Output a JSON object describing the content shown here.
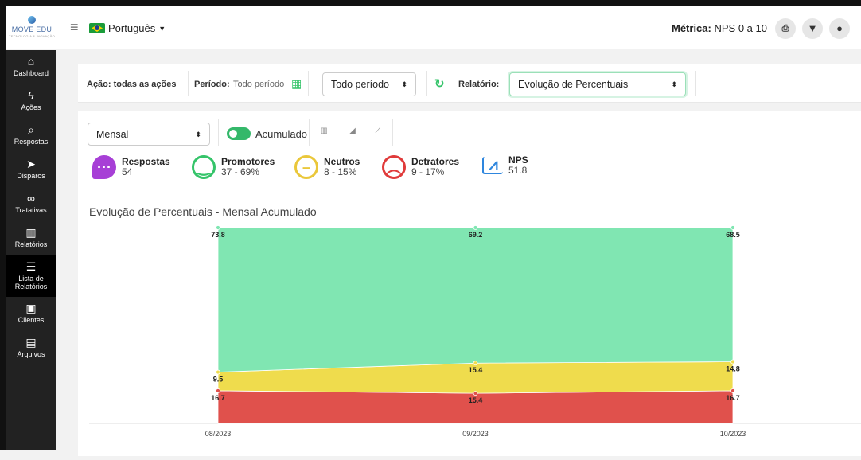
{
  "header": {
    "logo_text": "MOVE EDU",
    "logo_tagline": "TECNOLOGIA & INOVAÇÃO",
    "language": "Português",
    "metric_label": "Métrica:",
    "metric_value": "NPS 0 a 10"
  },
  "sidebar": {
    "items": [
      {
        "label": "Dashboard",
        "icon": "home-icon"
      },
      {
        "label": "Ações",
        "icon": "bolt-icon"
      },
      {
        "label": "Respostas",
        "icon": "search-icon"
      },
      {
        "label": "Disparos",
        "icon": "send-icon"
      },
      {
        "label": "Tratativas",
        "icon": "infinity-icon"
      },
      {
        "label": "Relatórios",
        "icon": "bar-chart-icon"
      },
      {
        "label": "Lista de Relatórios",
        "icon": "list-icon"
      },
      {
        "label": "Clientes",
        "icon": "contact-icon"
      },
      {
        "label": "Arquivos",
        "icon": "archive-icon"
      }
    ]
  },
  "filters": {
    "action_label": "Ação: todas as ações",
    "period_label": "Período:",
    "period_value": "Todo período",
    "period_select": "Todo período",
    "report_label": "Relatório:",
    "report_select": "Evolução de Percentuais"
  },
  "controls": {
    "interval": "Mensal",
    "cumulative_label": "Acumulado",
    "cumulative_on": true
  },
  "kpis": [
    {
      "title": "Respostas",
      "value": "54",
      "color": "#a73fd6",
      "icon": "chat-icon"
    },
    {
      "title": "Promotores",
      "value": "37 - 69%",
      "color": "#35c46a",
      "icon": "smile-icon"
    },
    {
      "title": "Neutros",
      "value": "8 - 15%",
      "color": "#eac73a",
      "icon": "neutral-face-icon"
    },
    {
      "title": "Detratores",
      "value": "9 - 17%",
      "color": "#e03b3b",
      "icon": "sad-face-icon"
    },
    {
      "title": "NPS",
      "value": "51.8",
      "color": "#2e86de",
      "icon": "trend-icon"
    }
  ],
  "chart_data": {
    "type": "area",
    "stacked": true,
    "title": "Evolução de Percentuais - Mensal Acumulado",
    "x": [
      "08/2023",
      "09/2023",
      "10/2023"
    ],
    "series": [
      {
        "name": "Detratores",
        "values": [
          16.7,
          15.4,
          16.7
        ],
        "color": "#e0514c"
      },
      {
        "name": "Neutros",
        "values": [
          9.5,
          15.4,
          14.8
        ],
        "color": "#efdc4d"
      },
      {
        "name": "Promotores",
        "values": [
          73.8,
          69.2,
          68.5
        ],
        "color": "#80e6b2"
      }
    ],
    "ylim": [
      0,
      100
    ],
    "grid": false,
    "legend": "none"
  }
}
